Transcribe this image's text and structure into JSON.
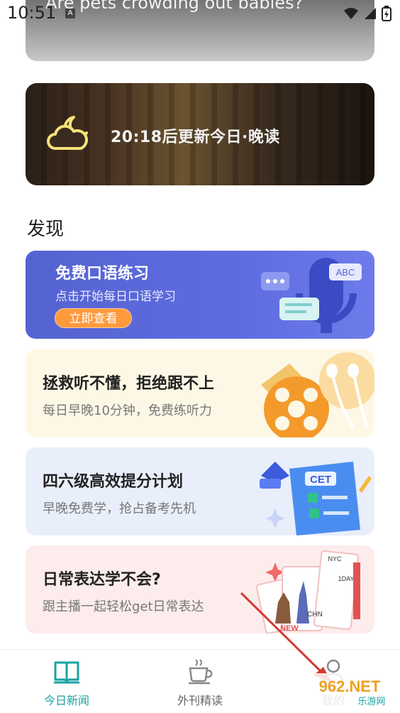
{
  "status": {
    "time": "10:51",
    "notify_glyph": "A",
    "icons": [
      "wifi-icon",
      "signal-icon",
      "battery-icon"
    ]
  },
  "top_article": {
    "title": "Are pets crowding out babies?"
  },
  "evening_banner": {
    "text": "20:18后更新今日·晚读",
    "icon": "cloud-moon-icon"
  },
  "discover": {
    "title": "发现",
    "cards": [
      {
        "title": "免费口语练习",
        "subtitle": "点击开始每日口语学习",
        "button": "立即查看",
        "art_text": "ABC"
      },
      {
        "title": "拯救听不懂，拒绝跟不上",
        "subtitle": "每日早晚10分钟，免费练听力"
      },
      {
        "title": "四六级高效提分计划",
        "subtitle": "早晚免费学，抢占备考先机",
        "art_text": "CET"
      },
      {
        "title": "日常表达学不会?",
        "subtitle": "跟主播一起轻松get日常表达",
        "art_text": [
          "NYC",
          "1DAY",
          "CHN",
          "NEW"
        ]
      }
    ]
  },
  "nav": {
    "items": [
      {
        "label": "今日新闻",
        "icon": "book-icon"
      },
      {
        "label": "外刊精读",
        "icon": "coffee-icon"
      },
      {
        "label": "我的",
        "icon": "user-icon"
      }
    ]
  },
  "watermark": {
    "brand": "962.NET",
    "sub": "乐游网"
  },
  "colors": {
    "accent": "#1aa3a3",
    "speaking_card": "#5e6ce0",
    "button_orange": "#ff9a3c",
    "listen_card": "#fdf8e6",
    "cet_card": "#e9eefb",
    "daily_card": "#fdecec"
  }
}
